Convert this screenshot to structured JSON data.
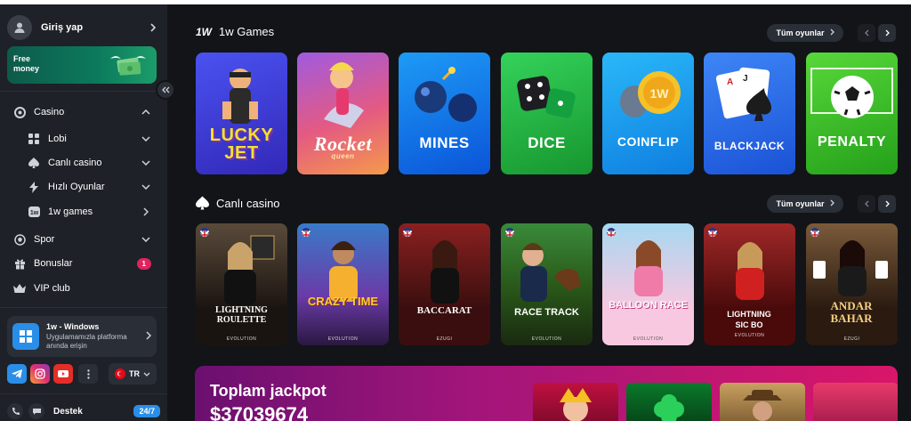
{
  "sidebar": {
    "login_label": "Giriş yap",
    "promo_text": "Free money",
    "nav": {
      "casino": "Casino",
      "lobi": "Lobi",
      "canli": "Canlı casino",
      "hizli": "Hızlı Oyunlar",
      "games1w": "1w games",
      "spor": "Spor",
      "bonuslar": "Bonuslar",
      "bonus_count": "1",
      "vip": "VIP club"
    },
    "windows_title": "1w - Windows",
    "windows_desc": "Uygulamamızla platforma anında erişin",
    "lang": "TR",
    "support": "Destek",
    "support_badge": "24/7"
  },
  "games_section": {
    "logo": "1W",
    "title": "1w Games",
    "all_label": "Tüm oyunlar",
    "cards": [
      {
        "name1": "LUCKY",
        "name2": "JET",
        "bg": "#3d3ad6"
      },
      {
        "name1": "Rocket",
        "name2": "queen",
        "bg": "#e45a82"
      },
      {
        "name1": "MINES",
        "name2": "",
        "bg": "#1f7cf0"
      },
      {
        "name1": "DICE",
        "name2": "",
        "bg": "#26b844"
      },
      {
        "name1": "COINFLIP",
        "name2": "",
        "bg": "#1aa8f0"
      },
      {
        "name1": "BLACKJACK",
        "name2": "",
        "bg": "#2a6ff0"
      },
      {
        "name1": "PENALTY",
        "name2": "",
        "bg": "#3cc62a"
      }
    ]
  },
  "live_section": {
    "title": "Canlı casino",
    "all_label": "Tüm oyunlar",
    "cards": [
      {
        "label": "LIGHTNING ROULETTE",
        "provider": "EVOLUTION"
      },
      {
        "label": "CRAZY TIME",
        "provider": "EVOLUTION"
      },
      {
        "label": "BACCARAT",
        "provider": "EZUGI"
      },
      {
        "label": "RACE TRACK",
        "provider": "EVOLUTION"
      },
      {
        "label": "BALLOON RACE",
        "provider": "EVOLUTION"
      },
      {
        "label": "LIGHTNING SIC BO",
        "provider": "EVOLUTION"
      },
      {
        "label": "ANDAR BAHAR",
        "provider": "EZUGI"
      }
    ]
  },
  "jackpot": {
    "title": "Toplam jackpot",
    "amount": "$37039674"
  },
  "colors": {
    "accent_blue": "#2a8ee8",
    "badge_red": "#e0245e",
    "sidebar_bg": "#1e2127",
    "main_bg": "#121418"
  }
}
